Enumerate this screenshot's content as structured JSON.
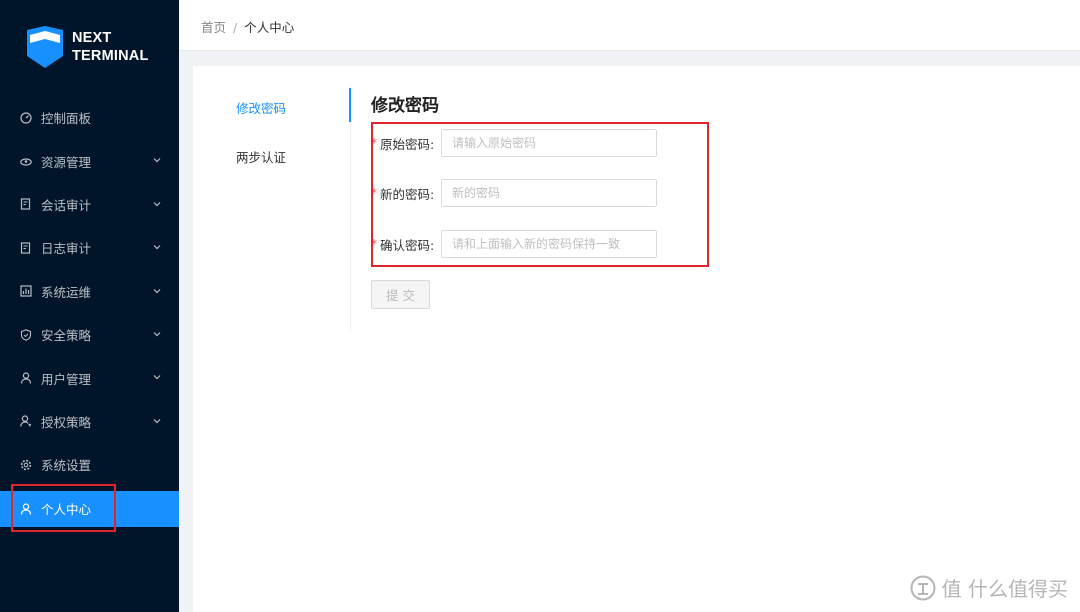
{
  "brand": {
    "line1": "NEXT",
    "line2": "TERMINAL",
    "color": "#1890ff"
  },
  "sidebar": {
    "items": [
      {
        "label": "控制面板",
        "icon": "dashboard-icon",
        "expandable": false
      },
      {
        "label": "资源管理",
        "icon": "cloud-server-icon",
        "expandable": true
      },
      {
        "label": "会话审计",
        "icon": "audit-doc-icon",
        "expandable": true
      },
      {
        "label": "日志审计",
        "icon": "log-doc-icon",
        "expandable": true
      },
      {
        "label": "系统运维",
        "icon": "ops-chart-icon",
        "expandable": true
      },
      {
        "label": "安全策略",
        "icon": "shield-icon",
        "expandable": true
      },
      {
        "label": "用户管理",
        "icon": "user-icon",
        "expandable": true
      },
      {
        "label": "授权策略",
        "icon": "user-key-icon",
        "expandable": true
      },
      {
        "label": "系统设置",
        "icon": "gear-icon",
        "expandable": false
      },
      {
        "label": "个人中心",
        "icon": "user-icon",
        "expandable": false,
        "active": true
      }
    ]
  },
  "breadcrumb": {
    "home": "首页",
    "separator": "/",
    "current": "个人中心"
  },
  "tabs": [
    {
      "label": "修改密码",
      "active": true
    },
    {
      "label": "两步认证",
      "active": false
    }
  ],
  "form": {
    "title": "修改密码",
    "required_mark": "*",
    "fields": [
      {
        "label": "原始密码:",
        "placeholder": "请输入原始密码",
        "value": ""
      },
      {
        "label": "新的密码:",
        "placeholder": "新的密码",
        "value": ""
      },
      {
        "label": "确认密码:",
        "placeholder": "请和上面输入新的密码保持一致",
        "value": ""
      }
    ],
    "submit_label": "提交"
  },
  "colors": {
    "sidebar_bg": "#001529",
    "accent": "#1890ff",
    "highlight": "#e0242b",
    "required": "#ff4d4f"
  },
  "watermark": {
    "text": "值 什么值得买"
  }
}
